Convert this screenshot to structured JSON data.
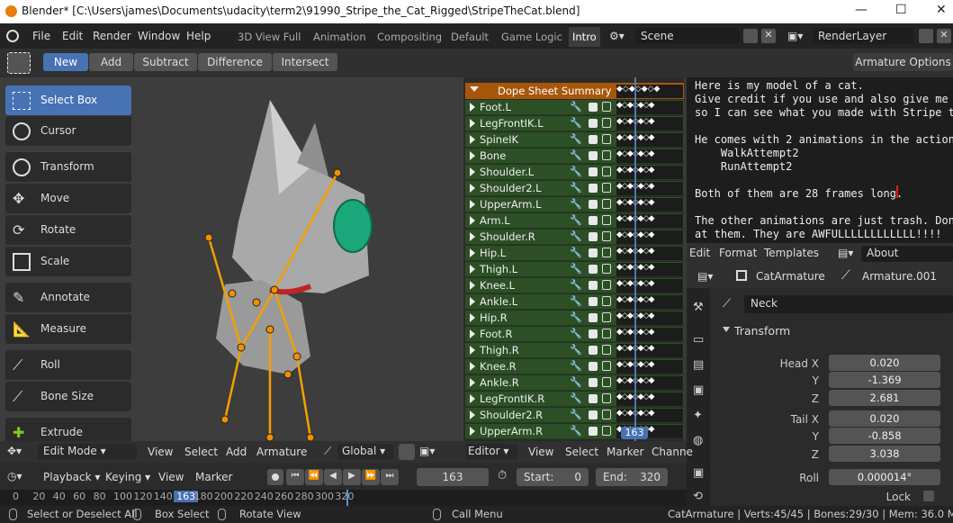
{
  "window": {
    "title": "Blender* [C:\\Users\\james\\Documents\\udacity\\term2\\91990_Stripe_the_Cat_Rigged\\StripeTheCat.blend]",
    "min": "—",
    "max": "☐",
    "close": "✕"
  },
  "menu": [
    "File",
    "Edit",
    "Render",
    "Window",
    "Help"
  ],
  "workspaces": [
    "3D View Full",
    "Animation",
    "Compositing",
    "Default",
    "Game Logic",
    "Intro"
  ],
  "scene": {
    "value": "Scene"
  },
  "renderlayer": {
    "value": "RenderLayer"
  },
  "modes": {
    "new": "New",
    "add": "Add",
    "subtract": "Subtract",
    "difference": "Difference",
    "intersect": "Intersect"
  },
  "armature_options": "Armature Options",
  "tools": [
    "Select Box",
    "Cursor",
    "Transform",
    "Move",
    "Rotate",
    "Scale",
    "Annotate",
    "Measure",
    "Roll",
    "Bone Size",
    "Extrude"
  ],
  "dopesheet": {
    "summary": "Dope Sheet Summary",
    "channels": [
      "Foot.L",
      "LegFrontIK.L",
      "SpineIK",
      "Bone",
      "Shoulder.L",
      "Shoulder2.L",
      "UpperArm.L",
      "Arm.L",
      "Shoulder.R",
      "Hip.L",
      "Thigh.L",
      "Knee.L",
      "Ankle.L",
      "Hip.R",
      "Foot.R",
      "Thigh.R",
      "Knee.R",
      "Ankle.R",
      "LegFrontIK.R",
      "Shoulder2.R",
      "UpperArm.R"
    ],
    "keys": "◆◇◆◇◆◇◆",
    "frame_badge": "163"
  },
  "text_editor": {
    "lines": [
      "Here is my model of a cat.",
      "Give credit if you use and also give me a",
      "so I can see what you made with Stripe th",
      "",
      "He comes with 2 animations in the action",
      "    WalkAttempt2",
      "    RunAttempt2",
      "",
      "Both of them are 28 frames long.",
      "",
      "The other animations are just trash. Don'",
      "at them. They are AWFULLLLLLLLLLLL!!!!"
    ],
    "menu": [
      "Edit",
      "Format",
      "Templates"
    ],
    "file": "About"
  },
  "properties": {
    "object": "CatArmature",
    "data": "Armature.001",
    "bone": "Neck",
    "panel": "Transform",
    "head_label": "Head X",
    "tail_label": "Tail X",
    "y": "Y",
    "z": "Z",
    "head": [
      "0.020",
      "-1.369",
      "2.681"
    ],
    "tail": [
      "0.020",
      "-0.858",
      "3.038"
    ],
    "roll_label": "Roll",
    "roll": "0.000014°",
    "lock": "Lock"
  },
  "vp_header": {
    "mode": "Edit Mode",
    "view": "View",
    "select": "Select",
    "add": "Add",
    "armature": "Armature",
    "orient": "Global"
  },
  "dope_header": {
    "editor": "Editor",
    "view": "View",
    "select": "Select",
    "marker": "Marker",
    "channel": "Channe"
  },
  "timeline": {
    "playback": "Playback",
    "keying": "Keying",
    "view": "View",
    "marker": "Marker",
    "current": "163",
    "start_label": "Start:",
    "start": "0",
    "end_label": "End:",
    "end": "320",
    "ticks": [
      "0",
      "20",
      "40",
      "60",
      "80",
      "100",
      "120",
      "140",
      "163",
      "180",
      "200",
      "220",
      "240",
      "260",
      "280",
      "300",
      "320"
    ]
  },
  "status": {
    "a": "Select or Deselect All",
    "b": "Box Select",
    "c": "Rotate View",
    "d": "Call Menu",
    "e": "CatArmature | Verts:45/45 | Bones:29/30 | Mem: 36.0 MB | v2.8"
  }
}
